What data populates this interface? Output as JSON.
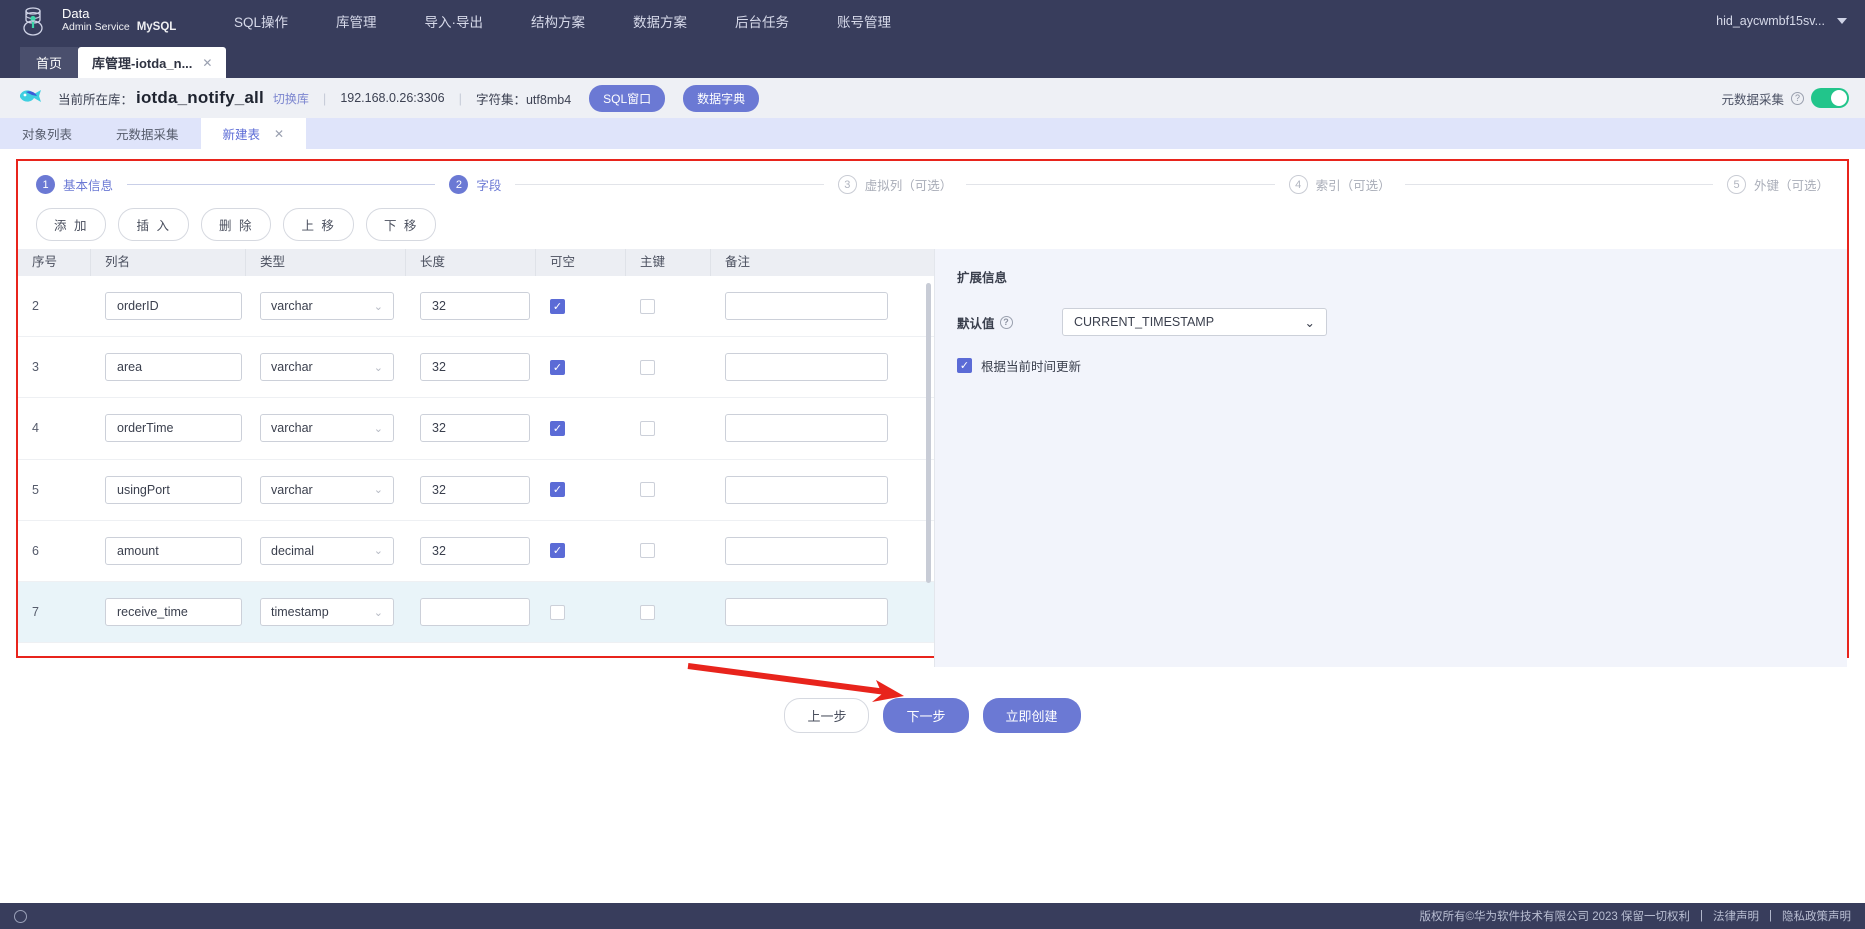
{
  "topnav": {
    "brand": {
      "line1": "Data",
      "line2": "Admin Service",
      "product": "MySQL",
      "logo_icon": "database-stack-icon"
    },
    "items": [
      {
        "label": "SQL操作",
        "name": "nav-sql-operation"
      },
      {
        "label": "库管理",
        "name": "nav-db-management"
      },
      {
        "label": "导入·导出",
        "name": "nav-import-export"
      },
      {
        "label": "结构方案",
        "name": "nav-structure-plan"
      },
      {
        "label": "数据方案",
        "name": "nav-data-plan"
      },
      {
        "label": "后台任务",
        "name": "nav-background-task"
      },
      {
        "label": "账号管理",
        "name": "nav-account-management"
      }
    ],
    "user": "hid_aycwmbf15sv...",
    "user_caret_icon": "chevron-down-icon"
  },
  "tabstrip": {
    "home_label": "首页",
    "active_label": "库管理-iotda_n...",
    "close_icon": "close-icon",
    "close_glyph": "✕"
  },
  "dbbar": {
    "db_icon": "database-fish-icon",
    "prefix": "当前所在库：",
    "db_name": "iotda_notify_all",
    "switch_label": "切换库",
    "separator": "|",
    "host": "192.168.0.26:3306",
    "charset": "字符集：utf8mb4",
    "buttons": [
      {
        "label": "SQL窗口",
        "name": "sql-window-button"
      },
      {
        "label": "数据字典",
        "name": "data-dictionary-button"
      }
    ],
    "meta_collect_label": "元数据采集",
    "help_icon": "question-mark-icon",
    "help_glyph": "?",
    "toggle_on": true,
    "toggle_color": "#22c58b"
  },
  "subtabs": [
    {
      "label": "对象列表",
      "name": "subtab-object-list",
      "active": false
    },
    {
      "label": "元数据采集",
      "name": "subtab-metadata-collect",
      "active": false
    },
    {
      "label": "新建表",
      "name": "subtab-new-table",
      "active": true
    }
  ],
  "subtab_close_glyph": "✕",
  "steps": [
    {
      "num": "1",
      "label": "基本信息",
      "state": "done"
    },
    {
      "num": "2",
      "label": "字段",
      "state": "cur"
    },
    {
      "num": "3",
      "label": "虚拟列（可选）",
      "state": "todo"
    },
    {
      "num": "4",
      "label": "索引（可选）",
      "state": "todo"
    },
    {
      "num": "5",
      "label": "外键（可选）",
      "state": "todo"
    }
  ],
  "toolbar": [
    {
      "label": "添 加",
      "name": "add-button"
    },
    {
      "label": "插 入",
      "name": "insert-button"
    },
    {
      "label": "删 除",
      "name": "delete-button"
    },
    {
      "label": "上 移",
      "name": "move-up-button"
    },
    {
      "label": "下 移",
      "name": "move-down-button"
    }
  ],
  "table": {
    "headers": [
      "序号",
      "列名",
      "类型",
      "长度",
      "可空",
      "主键",
      "备注"
    ],
    "rows": [
      {
        "seq": "2",
        "name": "orderID",
        "type": "varchar",
        "length": "32",
        "nullable": true,
        "pk": false,
        "note": "",
        "selected": false
      },
      {
        "seq": "3",
        "name": "area",
        "type": "varchar",
        "length": "32",
        "nullable": true,
        "pk": false,
        "note": "",
        "selected": false
      },
      {
        "seq": "4",
        "name": "orderTime",
        "type": "varchar",
        "length": "32",
        "nullable": true,
        "pk": false,
        "note": "",
        "selected": false
      },
      {
        "seq": "5",
        "name": "usingPort",
        "type": "varchar",
        "length": "32",
        "nullable": true,
        "pk": false,
        "note": "",
        "selected": false
      },
      {
        "seq": "6",
        "name": "amount",
        "type": "decimal",
        "length": "32",
        "nullable": true,
        "pk": false,
        "note": "",
        "selected": false
      },
      {
        "seq": "7",
        "name": "receive_time",
        "type": "timestamp",
        "length": "",
        "nullable": false,
        "pk": false,
        "note": "",
        "selected": true
      }
    ],
    "chevron_icon": "chevron-down-icon",
    "chevron_glyph": "⌄",
    "check_glyph": "✓"
  },
  "rightpanel": {
    "title": "扩展信息",
    "default_value_label": "默认值",
    "default_value": "CURRENT_TIMESTAMP",
    "help_glyph": "?",
    "update_on_current_time_label": "根据当前时间更新",
    "update_on_current_time_checked": true
  },
  "footer_buttons": [
    {
      "label": "上一步",
      "name": "previous-step-button",
      "style": "ghost"
    },
    {
      "label": "下一步",
      "name": "next-step-button",
      "style": "primary"
    },
    {
      "label": "立即创建",
      "name": "create-now-button",
      "style": "primary"
    }
  ],
  "annotation": {
    "arrow_color": "#e8241c",
    "highlight_color": "#e8241c"
  },
  "bottombar": {
    "globe_icon": "globe-icon",
    "copyright": "版权所有©华为软件技术有限公司 2023 保留一切权利",
    "sep": "|",
    "links": [
      {
        "label": "法律声明",
        "name": "legal-notice-link"
      },
      {
        "label": "隐私政策声明",
        "name": "privacy-policy-link"
      }
    ]
  }
}
